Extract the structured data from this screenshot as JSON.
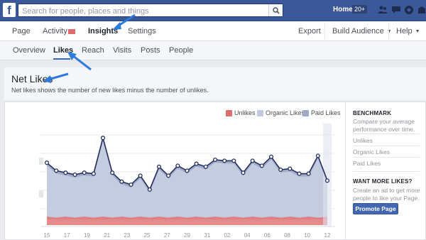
{
  "topbar": {
    "logo": "f",
    "search_placeholder": "Search for people, places and things",
    "home_label": "Home",
    "home_badge": "20+",
    "icons": [
      "friends-icon",
      "messages-icon",
      "notifications-icon",
      "privacy-icon"
    ]
  },
  "pagenav": {
    "left": [
      "Page",
      "Activity",
      "Insights",
      "Settings"
    ],
    "active": "Insights",
    "right": [
      "Export",
      "Build Audience",
      "Help"
    ]
  },
  "subtabs": {
    "items": [
      "Overview",
      "Likes",
      "Reach",
      "Visits",
      "Posts",
      "People"
    ],
    "active": "Likes"
  },
  "section": {
    "title": "Net Likes",
    "description": "Net likes shows the number of new likes minus the number of unlikes."
  },
  "legend": {
    "unlikes": "Unlikes",
    "organic": "Organic Likes",
    "paid": "Paid Likes"
  },
  "colors": {
    "unlikes": "#e06d6d",
    "organic": "#c3c9dd",
    "paid": "#9eaac6",
    "line": "#23305e",
    "brand": "#3b5998",
    "accent": "#4267b2"
  },
  "sidebar": {
    "benchmark_title": "BENCHMARK",
    "benchmark_text": "Compare your average performance over time.",
    "links": [
      "Unlikes",
      "Organic Likes",
      "Paid Likes"
    ],
    "more_title": "WANT MORE LIKES?",
    "more_text": "Create an ad to get more people to like your Page.",
    "promote_button": "Promote Page"
  },
  "chart_data": {
    "type": "area",
    "x": [
      "15",
      "16",
      "17",
      "18",
      "19",
      "20",
      "21",
      "22",
      "23",
      "24",
      "25",
      "26",
      "27",
      "28",
      "29",
      "30",
      "31",
      "01",
      "02",
      "03",
      "04",
      "05",
      "06",
      "07",
      "08",
      "09",
      "10",
      "11",
      "12",
      "13"
    ],
    "tick_labels": [
      "15",
      "17",
      "19",
      "21",
      "23",
      "25",
      "27",
      "29",
      "31",
      "02",
      "04",
      "06",
      "08",
      "10",
      "12"
    ],
    "series": [
      {
        "name": "Net Likes",
        "values": [
          57,
          49,
          47,
          45,
          47,
          46,
          82,
          47,
          38,
          35,
          44,
          30,
          53,
          44,
          54,
          49,
          56,
          53,
          60,
          59,
          59,
          47,
          59,
          54,
          63,
          50,
          51,
          46,
          46,
          64,
          39
        ]
      }
    ]
  }
}
